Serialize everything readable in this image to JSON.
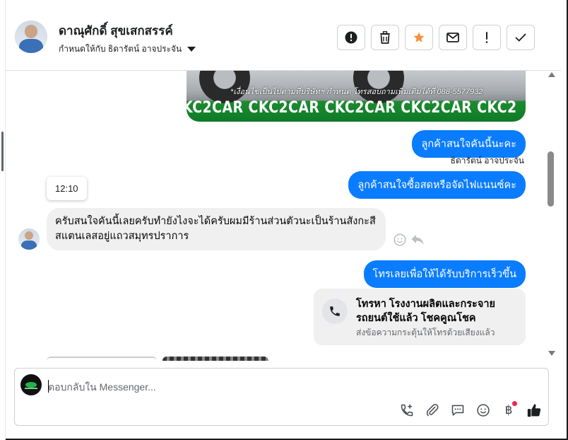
{
  "header": {
    "contact_name": "ดาณุศักดิ์ สุขเสกสรรค์",
    "assigned_to": "กำหนดให้กับ ธิดารัตน์ อาจประจัน",
    "actions": [
      {
        "name": "spam-button",
        "icon": "exclamation-circle-icon"
      },
      {
        "name": "delete-button",
        "icon": "trash-icon"
      },
      {
        "name": "star-button",
        "icon": "star-icon",
        "color": "#f7923b"
      },
      {
        "name": "mark-unread-button",
        "icon": "envelope-icon"
      },
      {
        "name": "follow-up-button",
        "icon": "exclamation-icon"
      },
      {
        "name": "mark-done-button",
        "icon": "check-icon"
      }
    ]
  },
  "promo_image": {
    "note": "*เงื่อนไขเป็นไปตามที่บริษัทฯ กำหนด โทรสอบถามเพิ่มเติมได้ที่ 088-5577932",
    "band": "KC2CAR CKC2CAR CKC2CAR CKC2CAR CKC2"
  },
  "messages": {
    "out_1": "ลูกค้าสนใจคันนี้นะคะ",
    "sender_label": "ธิดารัตน์ อาจประจัน",
    "out_2": "ลูกค้าสนใจซื้อสดหรือจัดไฟแนนซ์คะ",
    "time_chip": "12:10",
    "in_1": "ครับสนใจคันนี้เลยครับทำยังไงจะได้ครับผมมีร้านส่วนตัวนะเป็นร้านสังกะสีสแตนเลสอยู่แถวสมุทรปราการ",
    "out_3": "โทรเลยเพื่อให้ได้รับบริการเร็วขึ้น",
    "call_card": {
      "title": "โทรหา โรงงานผลิตและกระจายรถยนต์ใช้แล้ว โชคคูณโชค",
      "subtitle": "ส่งข้อความกระตุ้นให้โทรด้วยเสียงแล้ว"
    }
  },
  "composer": {
    "placeholder": "ตอบกลับใน Messenger...",
    "baht_symbol": "฿"
  },
  "colors": {
    "accent": "#0a7cff",
    "incoming_bubble": "#f0f0f0",
    "star": "#f7923b"
  }
}
